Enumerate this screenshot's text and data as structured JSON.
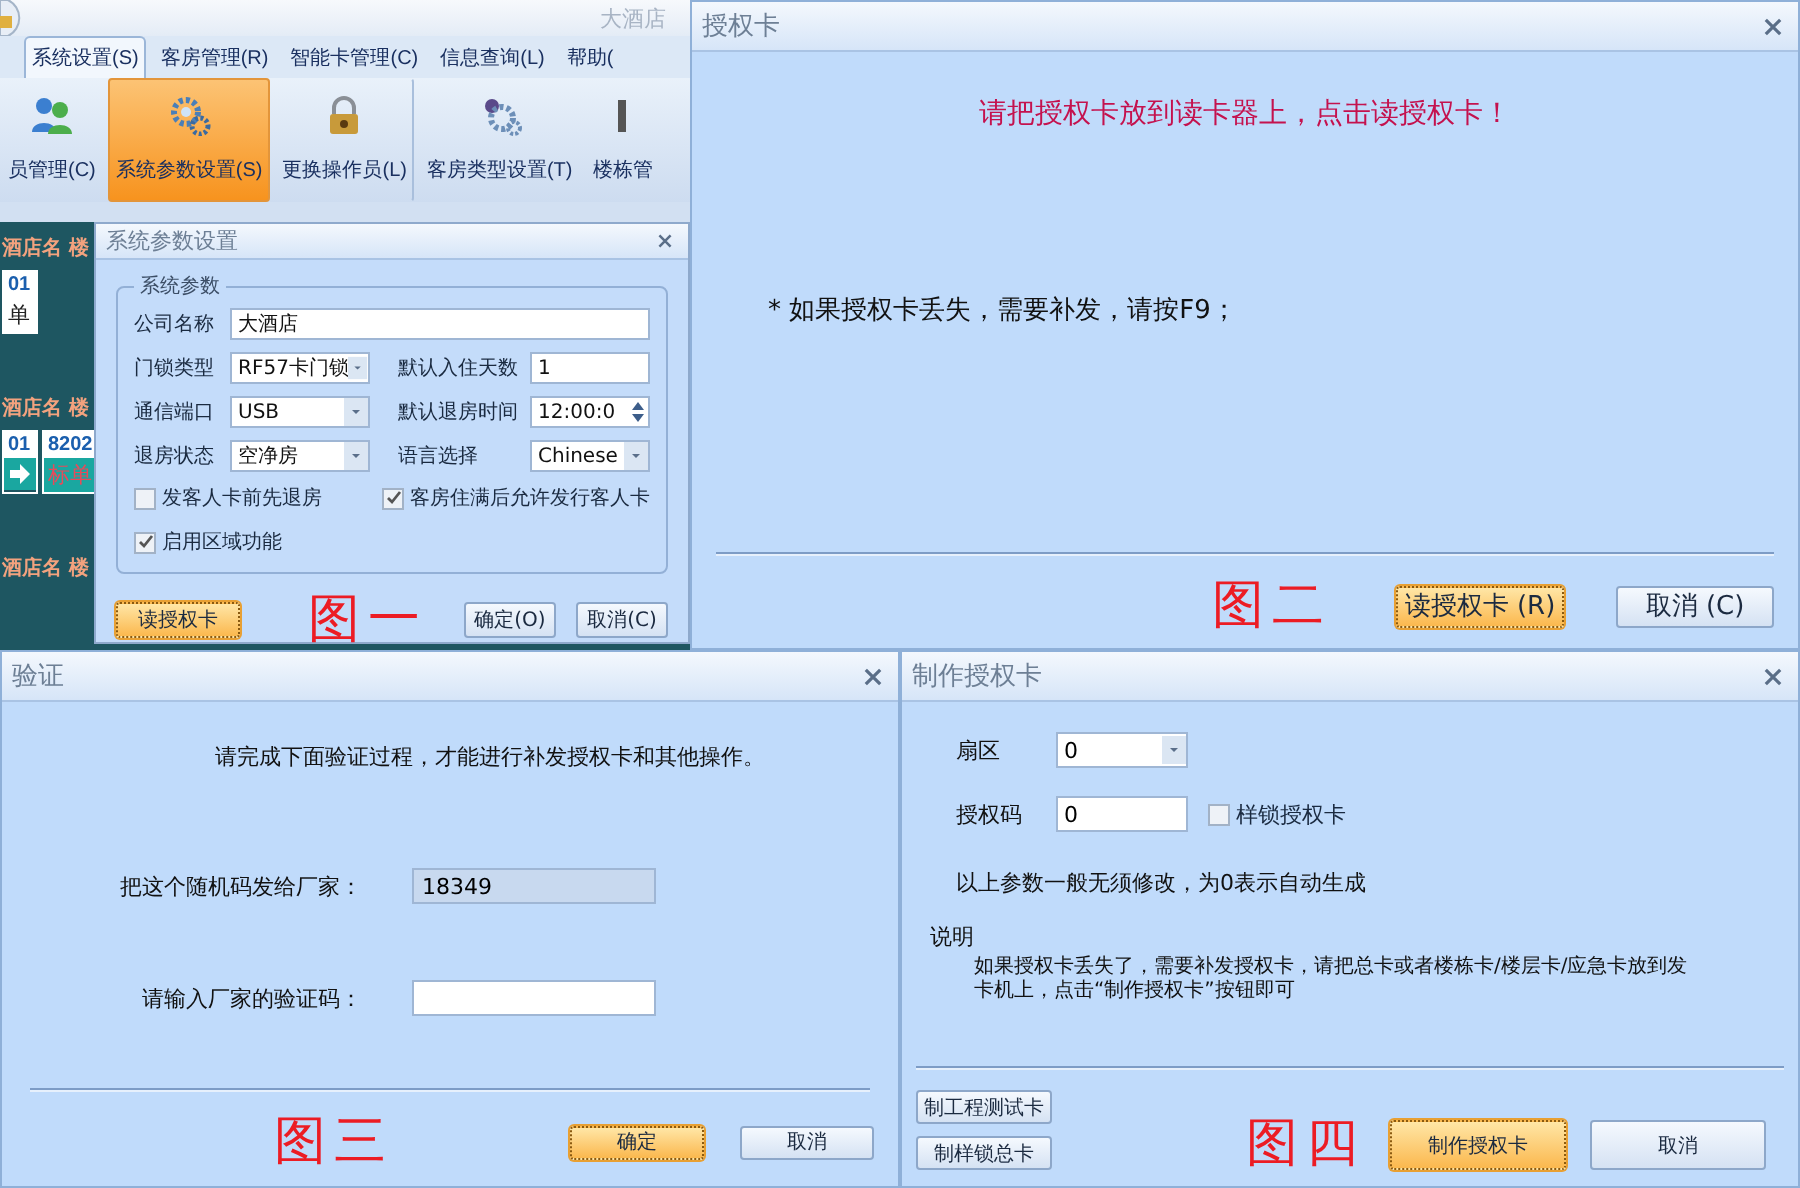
{
  "figure_1": {
    "app_title": "大酒店",
    "tabs": [
      {
        "label": "系统设置(S)",
        "selected": true
      },
      {
        "label": "客房管理(R)",
        "selected": false
      },
      {
        "label": "智能卡管理(C)",
        "selected": false
      },
      {
        "label": "信息查询(L)",
        "selected": false
      },
      {
        "label": "帮助(",
        "selected": false
      }
    ],
    "ribbon_buttons": [
      {
        "label": "员管理(C)",
        "selected": false
      },
      {
        "label": "系统参数设置(S)",
        "selected": true
      },
      {
        "label": "更换操作员(L)",
        "selected": false
      },
      {
        "label": "客房类型设置(T)",
        "selected": false
      },
      {
        "label": "楼栋管",
        "selected": false
      }
    ],
    "room_groups": [
      {
        "header": "酒店名 楼",
        "rooms": [
          {
            "number": "01",
            "type": "单"
          }
        ]
      },
      {
        "header": "酒店名 楼",
        "rooms": [
          {
            "number": "01"
          },
          {
            "number": "8202",
            "type": "标单"
          }
        ]
      },
      {
        "header": "酒店名 楼"
      }
    ],
    "dialog": {
      "title": "系统参数设置",
      "group_title": "系统参数",
      "company": {
        "label": "公司名称",
        "value": "大酒店"
      },
      "fields": [
        {
          "label": "门锁类型",
          "kind": "select",
          "value": "RF57卡门锁"
        },
        {
          "label": "默认入住天数",
          "kind": "text",
          "value": "1"
        },
        {
          "label": "通信端口",
          "kind": "select",
          "value": "USB"
        },
        {
          "label": "默认退房时间",
          "kind": "spin",
          "value": "12:00:0"
        },
        {
          "label": "退房状态",
          "kind": "select",
          "value": "空净房"
        },
        {
          "label": "语言选择",
          "kind": "select",
          "value": "Chinese"
        }
      ],
      "checkboxes": [
        {
          "label": "发客人卡前先退房",
          "checked": false
        },
        {
          "label": "客房住满后允许发行客人卡",
          "checked": true
        },
        {
          "label": "启用区域功能",
          "checked": true
        }
      ],
      "left_button": {
        "label": "读授权卡",
        "default": true
      },
      "buttons": [
        {
          "label": "确定(O)",
          "default": false
        },
        {
          "label": "取消(C)",
          "default": false
        }
      ]
    },
    "caption": "图一"
  },
  "figure_2": {
    "title": "授权卡",
    "prompt": "请把授权卡放到读卡器上，点击读授权卡！",
    "note": "* 如果授权卡丢失，需要补发，请按F9；",
    "buttons": [
      {
        "label": "读授权卡 (R)",
        "default": true
      },
      {
        "label": "取消 (C)",
        "default": false
      }
    ],
    "caption": "图二"
  },
  "figure_3": {
    "title": "验证",
    "instruction": "请完成下面验证过程，才能进行补发授权卡和其他操作。",
    "fields": [
      {
        "label": "把这个随机码发给厂家：",
        "value": "18349",
        "readonly": true
      },
      {
        "label": "请输入厂家的验证码：",
        "readonly": false
      }
    ],
    "buttons": [
      {
        "label": "确定",
        "default": true
      },
      {
        "label": "取消",
        "default": false
      }
    ],
    "caption": "图三"
  },
  "figure_4": {
    "title": "制作授权卡",
    "sector": {
      "label": "扇区",
      "value": "0"
    },
    "auth_code": {
      "label": "授权码",
      "value": "0"
    },
    "sample_lock": {
      "label": "样锁授权卡",
      "checked": false
    },
    "note": "以上参数一般无须修改，为0表示自动生成",
    "explain_title": "说明",
    "explain": "如果授权卡丢失了，需要补发授权卡，请把总卡或者楼栋卡/楼层卡/应急卡放到发卡机上，点击“制作授权卡”按钮即可",
    "side_buttons": [
      {
        "label": "制工程测试卡"
      },
      {
        "label": "制样锁总卡"
      }
    ],
    "buttons": [
      {
        "label": "制作授权卡",
        "default": true
      },
      {
        "label": "取消",
        "default": false
      }
    ],
    "caption": "图四"
  }
}
